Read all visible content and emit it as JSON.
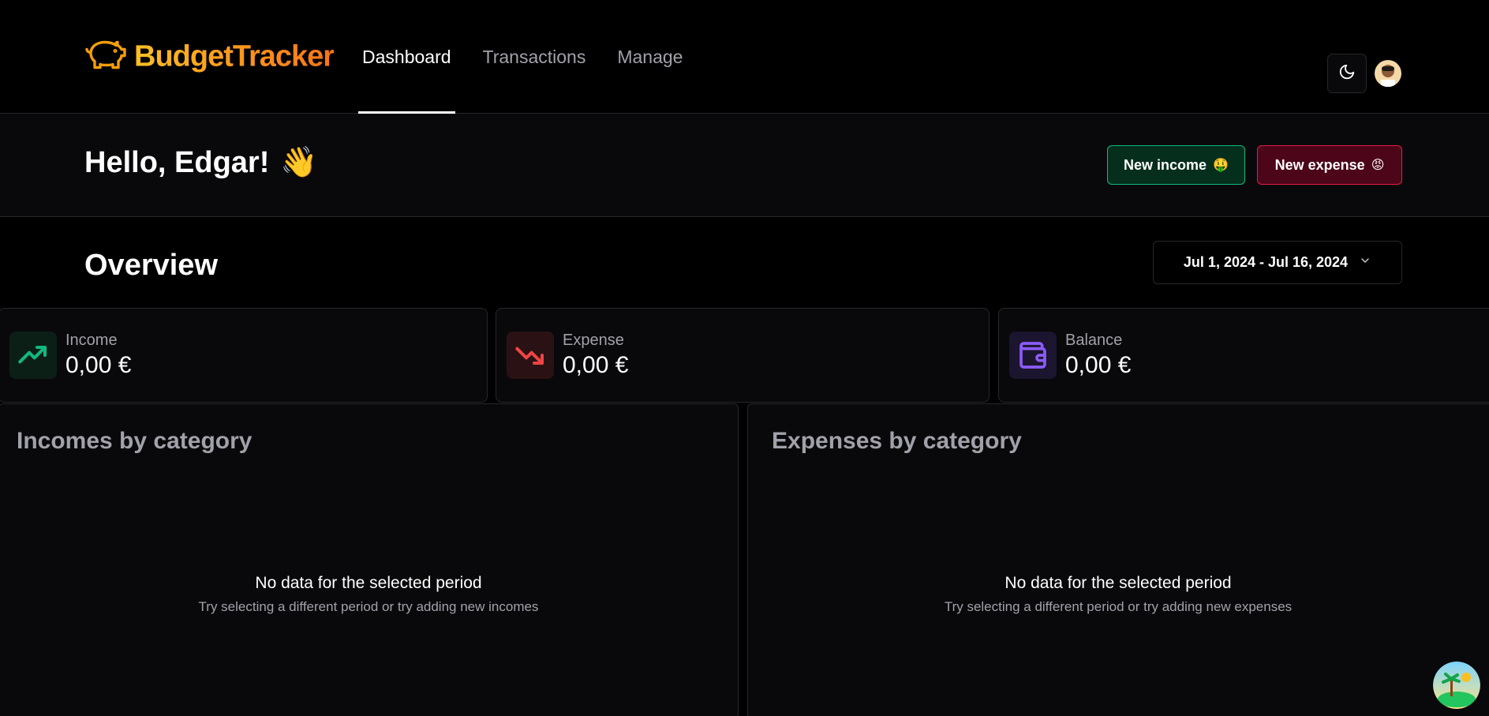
{
  "app": {
    "logo_text": "BudgetTracker",
    "brand_colors": [
      "#fbbf24",
      "#f97316"
    ]
  },
  "nav": {
    "links": [
      {
        "label": "Dashboard",
        "active": true
      },
      {
        "label": "Transactions",
        "active": false
      },
      {
        "label": "Manage",
        "active": false
      }
    ]
  },
  "header": {
    "theme_icon": "moon-icon",
    "avatar_icon": "user-avatar-icon"
  },
  "greeting": {
    "text": "Hello, Edgar!",
    "emoji": "👋"
  },
  "actions": {
    "new_income": "New income",
    "new_income_emoji": "🤑",
    "new_expense": "New expense",
    "new_expense_emoji": "😡"
  },
  "overview": {
    "title": "Overview",
    "date_range": "Jul 1, 2024 - Jul 16, 2024"
  },
  "stats": [
    {
      "label": "Income",
      "value": "0,00 €",
      "icon": "trending-up-icon",
      "color": "#10b981"
    },
    {
      "label": "Expense",
      "value": "0,00 €",
      "icon": "trending-down-icon",
      "color": "#ef4444"
    },
    {
      "label": "Balance",
      "value": "0,00 €",
      "icon": "wallet-icon",
      "color": "#8b5cf6"
    }
  ],
  "categories": {
    "incomes": {
      "title": "Incomes by category",
      "empty_title": "No data for the selected period",
      "empty_sub": "Try selecting a different period or try adding new incomes"
    },
    "expenses": {
      "title": "Expenses by category",
      "empty_title": "No data for the selected period",
      "empty_sub": "Try selecting a different period or try adding new expenses"
    }
  }
}
